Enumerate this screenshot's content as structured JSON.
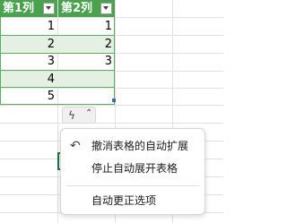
{
  "table": {
    "headers": [
      "第1列",
      "第2列"
    ],
    "rows": [
      [
        "1",
        "1"
      ],
      [
        "2",
        "2"
      ],
      [
        "3",
        "3"
      ],
      [
        "4",
        ""
      ],
      [
        "5",
        ""
      ]
    ]
  },
  "quick_action": {
    "icon": "lightning-icon",
    "chevron": "chevron-up-icon"
  },
  "menu": {
    "items": [
      {
        "label": "撤消表格的自动扩展",
        "icon": "undo-icon"
      },
      {
        "label": "停止自动展开表格"
      },
      {
        "label": "自动更正选项"
      }
    ]
  },
  "colors": {
    "header": "#4aa24f",
    "band": "#e4f0e3",
    "grid": "#e1e1e1"
  }
}
